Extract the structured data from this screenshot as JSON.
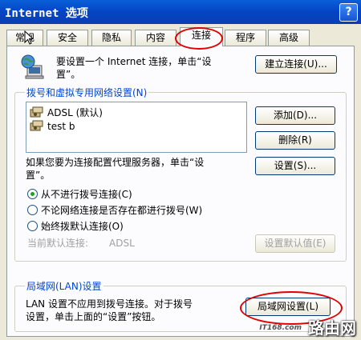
{
  "window": {
    "title": "Internet 选项",
    "help_label": "?"
  },
  "tabs": [
    {
      "label": "常规"
    },
    {
      "label": "安全"
    },
    {
      "label": "隐私"
    },
    {
      "label": "内容"
    },
    {
      "label": "连接",
      "active": true
    },
    {
      "label": "程序"
    },
    {
      "label": "高级"
    }
  ],
  "setup": {
    "text_line1": "要设置一个 Internet 连接，单击“设",
    "text_line2": "置”。",
    "button_label": "建立连接(U)..."
  },
  "dialup": {
    "group_title": "拨号和虚拟专用网络设置(N)",
    "connections": [
      {
        "name": "ADSL (默认)"
      },
      {
        "name": "test b"
      }
    ],
    "add_button": "添加(D)...",
    "delete_button": "删除(R)",
    "proxy_text_line1": "如果您要为连接配置代理服务器，单击“设",
    "proxy_text_line2": "置”。",
    "settings_button": "设置(S)...",
    "radio_options": [
      {
        "label": "从不进行拨号连接(C)",
        "checked": true
      },
      {
        "label": "不论网络连接是否存在都进行拨号(W)",
        "checked": false
      },
      {
        "label": "始终拨默认连接(O)",
        "checked": false
      }
    ],
    "current_default_label": "当前默认连接:",
    "current_default_value": "ADSL",
    "set_default_button": "设置默认值(E)"
  },
  "lan": {
    "group_title": "局域网(LAN)设置",
    "text_line1": "LAN 设置不应用到拨号连接。对于拨号",
    "text_line2": "设置，单击上面的“设置”按钮。",
    "button_label": "局域网设置(L)"
  },
  "watermark": {
    "text": "路由网",
    "site": "IT168.com"
  },
  "colors": {
    "accent_red": "#e00000",
    "legend_blue": "#0046d5"
  }
}
